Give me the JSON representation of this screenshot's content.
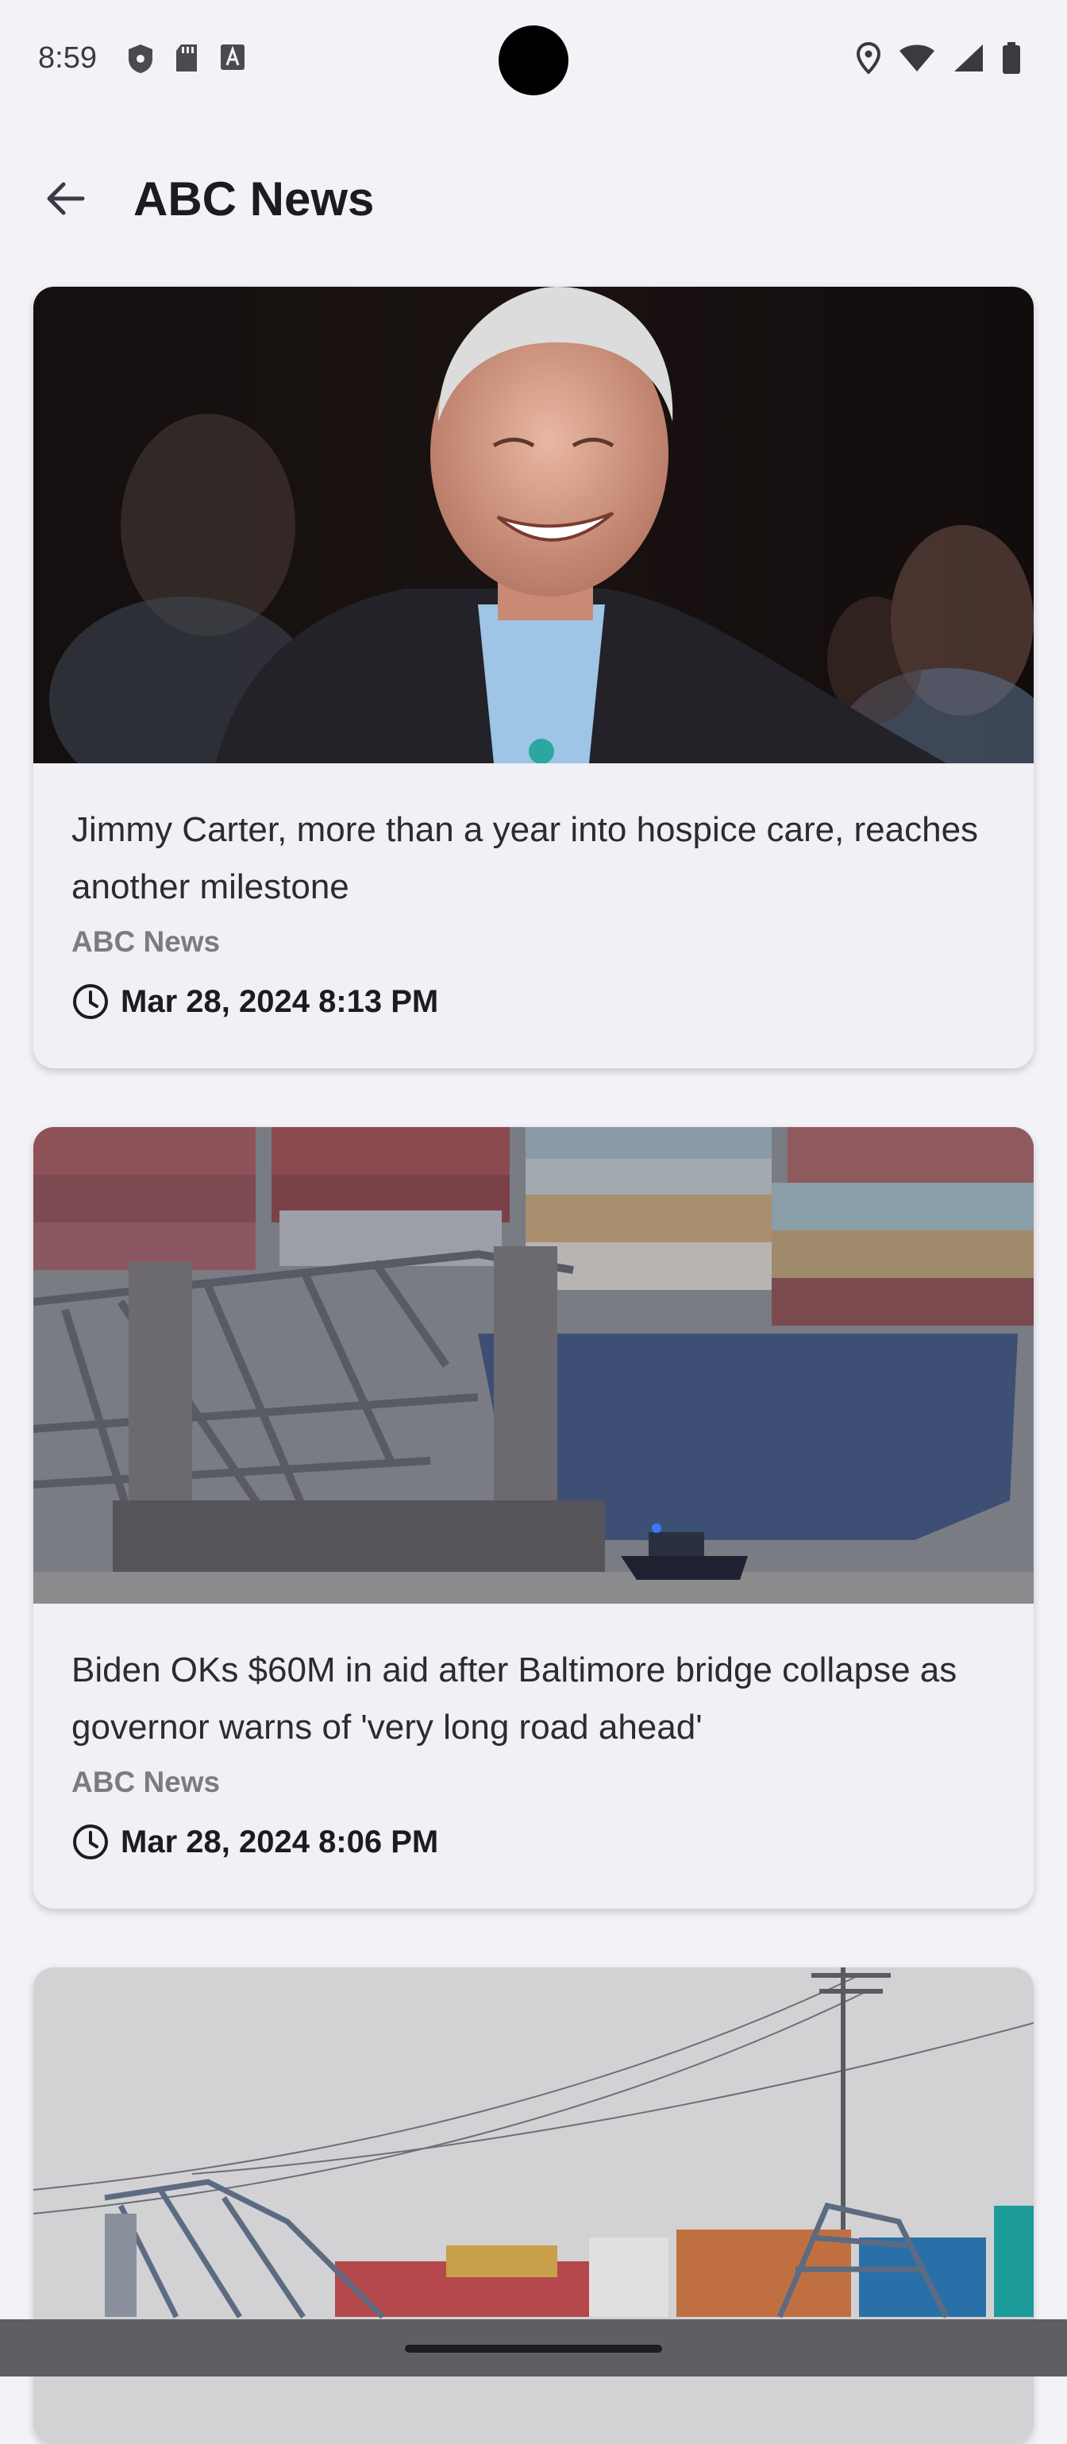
{
  "status_bar": {
    "time": "8:59",
    "left_icons": [
      "shield-icon",
      "sd-card-icon",
      "font-a-icon"
    ],
    "right_icons": [
      "location-icon",
      "wifi-icon",
      "signal-icon",
      "battery-icon"
    ]
  },
  "app_bar": {
    "title": "ABC News",
    "back_icon": "arrow-back-icon"
  },
  "articles": [
    {
      "headline": "Jimmy Carter, more than a year into hospice care, reaches another milestone",
      "source": "ABC News",
      "date": "Mar 28, 2024 8:13 PM"
    },
    {
      "headline": "Biden OKs $60M in aid after Baltimore bridge collapse as governor warns of 'very long road ahead'",
      "source": "ABC News",
      "date": "Mar 28, 2024 8:06 PM"
    },
    {
      "headline": "",
      "source": "",
      "date": ""
    }
  ],
  "colors": {
    "background": "#f3f2f7",
    "card": "#f0f0f5",
    "source_text": "#7b7b80",
    "nav_bar": "#5f5f63"
  }
}
